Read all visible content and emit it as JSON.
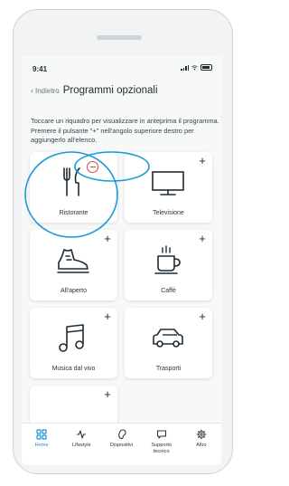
{
  "status_bar": {
    "time": "9:41"
  },
  "header": {
    "back_label": "Indietro",
    "title": "Programmi opzionali"
  },
  "description": "Toccare un riquadro per visualizzare in anteprima il programma. Premere il pulsante \"+\" nell'angolo superiore destro per aggiungerlo all'elenco.",
  "tiles": [
    {
      "label": "Ristorante",
      "icon": "cutlery-icon",
      "action": "remove"
    },
    {
      "label": "Televisione",
      "icon": "television-icon",
      "action": "add"
    },
    {
      "label": "All'aperto",
      "icon": "shoe-icon",
      "action": "add"
    },
    {
      "label": "Caffè",
      "icon": "coffee-cup-icon",
      "action": "add"
    },
    {
      "label": "Musica dal vivo",
      "icon": "music-note-icon",
      "action": "add"
    },
    {
      "label": "Trasporti",
      "icon": "car-icon",
      "action": "add"
    }
  ],
  "add_symbol": "+",
  "bottom_nav": [
    {
      "label": "Home",
      "icon": "grid-icon",
      "active": true
    },
    {
      "label": "Lifestyle",
      "icon": "pulse-icon",
      "active": false
    },
    {
      "label": "Dispositivi",
      "icon": "hearing-aid-icon",
      "active": false
    },
    {
      "label": "Supporto tecnico",
      "icon": "chat-icon",
      "active": false
    },
    {
      "label": "Altro",
      "icon": "gear-icon",
      "active": false
    }
  ],
  "colors": {
    "accent": "#1a9bd7",
    "remove": "#d04a4a",
    "text": "#1f2a33"
  }
}
